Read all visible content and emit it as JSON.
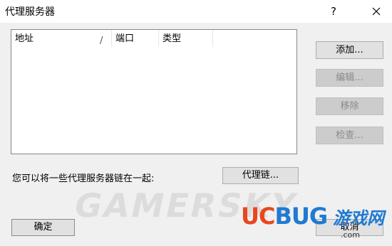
{
  "window": {
    "title": "代理服务器",
    "help_glyph": "?"
  },
  "list": {
    "columns": [
      "地址",
      "端口",
      "类型"
    ],
    "sort_indicator": "/"
  },
  "buttons": {
    "add": "添加...",
    "edit": "编辑...",
    "remove": "移除",
    "check": "检查...",
    "chain": "代理链...",
    "ok": "确定",
    "cancel": "取消"
  },
  "chain_label": "您可以将一些代理服务器链在一起:",
  "watermarks": {
    "gamersky": "GAMERSKY",
    "ucbug_uc": "UC",
    "ucbug_bug": "BUG",
    "ucbug_game": "游戏网",
    "ucbug_site": ".com"
  }
}
